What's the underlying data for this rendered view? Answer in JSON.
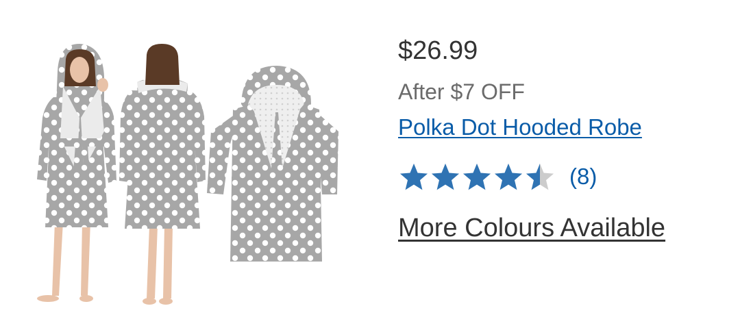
{
  "product": {
    "image_alt": "Polka Dot Hooded Robe",
    "price": "$26.99",
    "discount": "After $7 OFF",
    "title": "Polka Dot Hooded Robe",
    "rating": {
      "value": 4.5,
      "max": 5,
      "count_label": "(8)"
    },
    "more_colours_label": "More Colours Available"
  },
  "colors": {
    "star_filled": "#2f73b3",
    "star_empty": "#cccccc",
    "link": "#0a5ca8",
    "price_text": "#333333",
    "discount_text": "#6b6b6b",
    "robe_grey": "#a7a7a7",
    "robe_dots": "#ffffff",
    "collar": "#ebebeb",
    "skin": "#e8c2a8",
    "hair": "#5a3a26"
  }
}
